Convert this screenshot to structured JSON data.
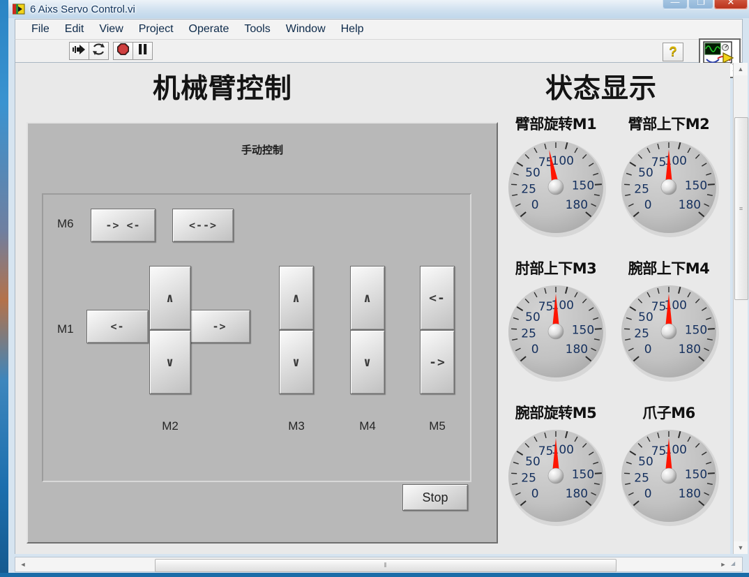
{
  "window": {
    "title": "6 Aixs Servo Control.vi",
    "caption_buttons": [
      {
        "name": "minimize",
        "glyph": "—"
      },
      {
        "name": "maximize",
        "glyph": "❐"
      },
      {
        "name": "close",
        "glyph": "✕"
      }
    ]
  },
  "menubar": {
    "items": [
      "File",
      "Edit",
      "View",
      "Project",
      "Operate",
      "Tools",
      "Window",
      "Help"
    ]
  },
  "toolbar": {
    "buttons": [
      {
        "name": "run-button",
        "icon": "run-arrow-icon"
      },
      {
        "name": "run-continuously-button",
        "icon": "continuous-run-icon"
      },
      {
        "name": "abort-button",
        "icon": "abort-octagon-icon"
      },
      {
        "name": "pause-button",
        "icon": "pause-icon"
      }
    ],
    "help_glyph": "?",
    "vi_icon_badge": "1"
  },
  "panel": {
    "left_title": "机械臂控制",
    "right_title": "状态显示",
    "control_cluster_caption": "手动控制",
    "stop_label": "Stop",
    "axes": [
      {
        "name": "M6",
        "label": "M6",
        "label_position": "left",
        "buttons": [
          {
            "name": "m6-close-button",
            "label": "-> <-"
          },
          {
            "name": "m6-open-button",
            "label": "<-->"
          }
        ]
      },
      {
        "name": "M1",
        "label": "M1",
        "label_position": "left",
        "buttons": [
          {
            "name": "m1-left-button",
            "label": "<-"
          },
          {
            "name": "m1-right-button",
            "label": "->"
          }
        ]
      },
      {
        "name": "M2",
        "label": "M2",
        "label_position": "bottom",
        "buttons": [
          {
            "name": "m2-up-button",
            "label": "∧"
          },
          {
            "name": "m2-down-button",
            "label": "∨"
          }
        ]
      },
      {
        "name": "M3",
        "label": "M3",
        "label_position": "bottom",
        "buttons": [
          {
            "name": "m3-up-button",
            "label": "∧"
          },
          {
            "name": "m3-down-button",
            "label": "∨"
          }
        ]
      },
      {
        "name": "M4",
        "label": "M4",
        "label_position": "bottom",
        "buttons": [
          {
            "name": "m4-up-button",
            "label": "∧"
          },
          {
            "name": "m4-down-button",
            "label": "∨"
          }
        ]
      },
      {
        "name": "M5",
        "label": "M5",
        "label_position": "bottom",
        "buttons": [
          {
            "name": "m5-left-button",
            "label": "<-"
          },
          {
            "name": "m5-right-button",
            "label": "->"
          }
        ]
      }
    ]
  },
  "chart_data": {
    "type": "gauge",
    "title": "状态显示",
    "scale_min": 0,
    "scale_max": 180,
    "tick_labels": [
      "0",
      "25",
      "50",
      "75",
      "100",
      "150",
      "180"
    ],
    "tick_values": [
      0,
      25,
      50,
      75,
      100,
      150,
      180
    ],
    "needle_color": "#ff1500",
    "dial_color": "#bfbfbf",
    "gauges": [
      {
        "name": "gauge-m1",
        "label": "臂部旋转M1",
        "value": 83
      },
      {
        "name": "gauge-m2",
        "label": "臂部上下M2",
        "value": 90
      },
      {
        "name": "gauge-m3",
        "label": "肘部上下M3",
        "value": 90
      },
      {
        "name": "gauge-m4",
        "label": "腕部上下M4",
        "value": 90
      },
      {
        "name": "gauge-m5",
        "label": "腕部旋转M5",
        "value": 90
      },
      {
        "name": "gauge-m6",
        "label": "爪子M6",
        "value": 90
      }
    ]
  },
  "scrollbars": {
    "vertical": {
      "up_glyph": "▲",
      "down_glyph": "▼",
      "grip": "≡"
    },
    "horizontal": {
      "left_glyph": "◄",
      "right_glyph": "►",
      "grip": "⦀"
    }
  }
}
